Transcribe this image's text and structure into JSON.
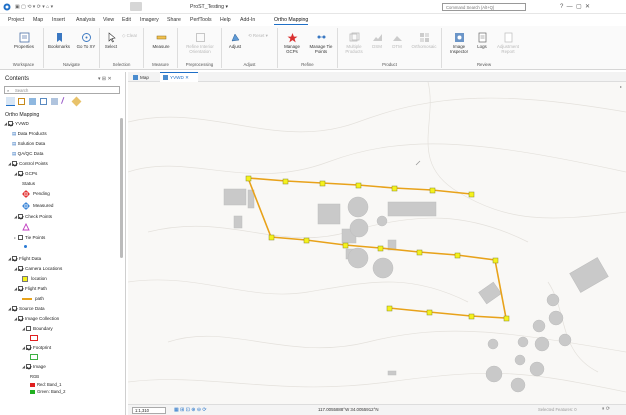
{
  "titlebar": {
    "project_name": "ProST_Testing ▾",
    "search_placeholder": "Command Search (Alt+Q)"
  },
  "menu": [
    "Project",
    "Map",
    "Insert",
    "Analysis",
    "View",
    "Edit",
    "Imagery",
    "Share",
    "PerfTools",
    "Help",
    "Add-In",
    "Ortho Mapping"
  ],
  "ribbon": {
    "groups": [
      "Workspace",
      "Navigate",
      "Selection",
      "Measure",
      "Preprocessing",
      "Adjust",
      "Refine",
      "Product",
      "Review"
    ],
    "buttons": {
      "properties": "Properties",
      "bookmarks": "Bookmarks",
      "goto": "Go To XY",
      "select": "Select",
      "clear": "Clear",
      "measure": "Measure",
      "refine_orient": "Refine Interior Orientation",
      "adjust": "Adjust",
      "reset": "Reset",
      "manage_gcps": "Manage GCPs",
      "manage_tie": "Manage Tie Points",
      "multiple_products": "Multiple Products",
      "dsm": "DSM",
      "dtm": "DTM",
      "orthomosaic": "Orthomosaic",
      "image_inspector": "Image Inspector",
      "logs": "Logs",
      "adjustment_report": "Adjustment Report"
    }
  },
  "contents": {
    "title": "Contents",
    "search_placeholder": "Search",
    "heading": "Ortho Mapping",
    "items": [
      {
        "label": "YVWD",
        "checked": true,
        "indent": 0
      },
      {
        "label": "Data Products",
        "indent": 1
      },
      {
        "label": "Solution Data",
        "indent": 1
      },
      {
        "label": "QA/QC Data",
        "indent": 1
      },
      {
        "label": "Control Points",
        "checked": true,
        "indent": 1
      },
      {
        "label": "GCPs",
        "checked": true,
        "indent": 2
      },
      {
        "label": "Status",
        "indent": 3
      },
      {
        "label": "Pending",
        "indent": 3
      },
      {
        "label": "Measured",
        "indent": 3
      },
      {
        "label": "Check Points",
        "checked": true,
        "indent": 2
      },
      {
        "label": "Tie Points",
        "checked": false,
        "indent": 2
      },
      {
        "label": "Flight Data",
        "checked": true,
        "indent": 1
      },
      {
        "label": "Camera Locations",
        "checked": true,
        "indent": 2
      },
      {
        "label": "location",
        "indent": 3
      },
      {
        "label": "Flight Path",
        "checked": true,
        "indent": 2
      },
      {
        "label": "path",
        "indent": 3
      },
      {
        "label": "Source Data",
        "checked": true,
        "indent": 1
      },
      {
        "label": "Image Collection",
        "checked": true,
        "indent": 2
      },
      {
        "label": "Boundary",
        "checked": false,
        "indent": 3
      },
      {
        "label": "Footprint",
        "checked": true,
        "indent": 3
      },
      {
        "label": "Image",
        "checked": true,
        "indent": 3
      },
      {
        "label": "RGB",
        "indent": 3
      },
      {
        "label": "Red: Band_1",
        "indent": 3
      },
      {
        "label": "Green: Band_2",
        "indent": 3
      }
    ]
  },
  "map_tabs": [
    {
      "label": "Map",
      "active": false
    },
    {
      "label": "YVWD",
      "active": true
    }
  ],
  "status": {
    "scale": "1:1,310",
    "coords": "117.0055888°W 34.0055912°N",
    "selected": "Selected Features: 0"
  },
  "colors": {
    "accent": "#1e6fc7",
    "flight_path": "#e8a21a",
    "camera_point": "#f5f21b",
    "pending": "#e02020",
    "checkpoint": "#c03cc0"
  }
}
